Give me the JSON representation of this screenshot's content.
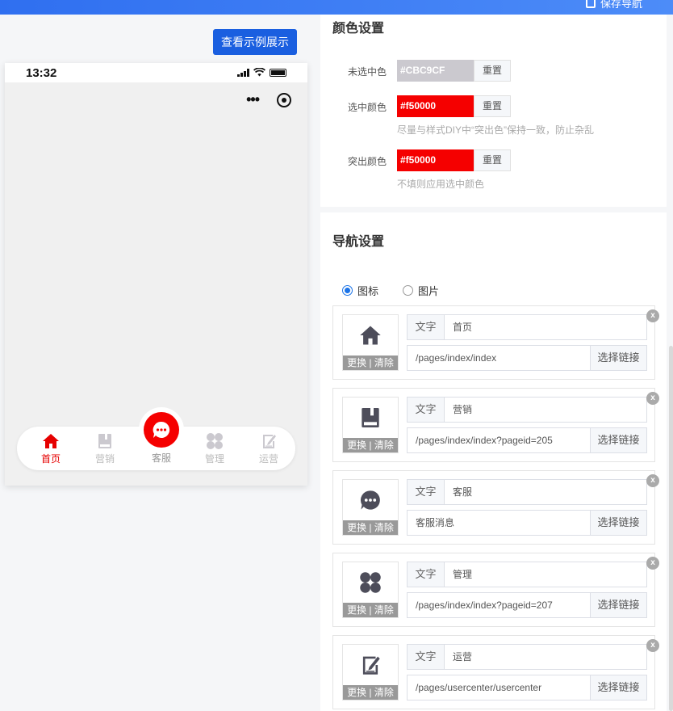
{
  "topbar": {
    "save_label": "保存导航"
  },
  "preview": {
    "example_button": "查看示例展示",
    "status_time": "13:32",
    "tabs": [
      {
        "label": "首页",
        "icon": "home-icon",
        "active": true
      },
      {
        "label": "营销",
        "icon": "book-icon",
        "active": false
      },
      {
        "label": "客服",
        "icon": "chat-icon",
        "active": false,
        "center": true
      },
      {
        "label": "管理",
        "icon": "clover-icon",
        "active": false
      },
      {
        "label": "运营",
        "icon": "edit-icon",
        "active": false
      }
    ],
    "active_color": "#f50000",
    "inactive_color": "#CBC9CF"
  },
  "color_settings": {
    "title": "颜色设置",
    "unselected": {
      "label": "未选中色",
      "value": "#CBC9CF",
      "reset": "重置"
    },
    "selected": {
      "label": "选中颜色",
      "value": "#f50000",
      "reset": "重置",
      "hint": "尽量与样式DIY中“突出色”保持一致，防止杂乱"
    },
    "highlight": {
      "label": "突出颜色",
      "value": "#f50000",
      "reset": "重置",
      "hint": "不填则应用选中颜色"
    }
  },
  "nav_settings": {
    "title": "导航设置",
    "radio": [
      {
        "label": "图标",
        "checked": true
      },
      {
        "label": "图片",
        "checked": false
      }
    ],
    "ops_label": "更换 | 清除",
    "text_prefix": "文字",
    "choose_link": "选择链接",
    "remove": "x",
    "items": [
      {
        "icon": "home-icon",
        "text": "首页",
        "link": "/pages/index/index",
        "has_choose": true
      },
      {
        "icon": "book-icon",
        "text": "营销",
        "link": "/pages/index/index?pageid=205",
        "has_choose": true
      },
      {
        "icon": "chat-icon",
        "text": "客服",
        "link": "客服消息",
        "has_choose": true
      },
      {
        "icon": "clover-icon",
        "text": "管理",
        "link": "/pages/index/index?pageid=207",
        "has_choose": true
      },
      {
        "icon": "edit-icon",
        "text": "运营",
        "link": "/pages/usercenter/usercenter",
        "has_choose": true
      }
    ]
  }
}
